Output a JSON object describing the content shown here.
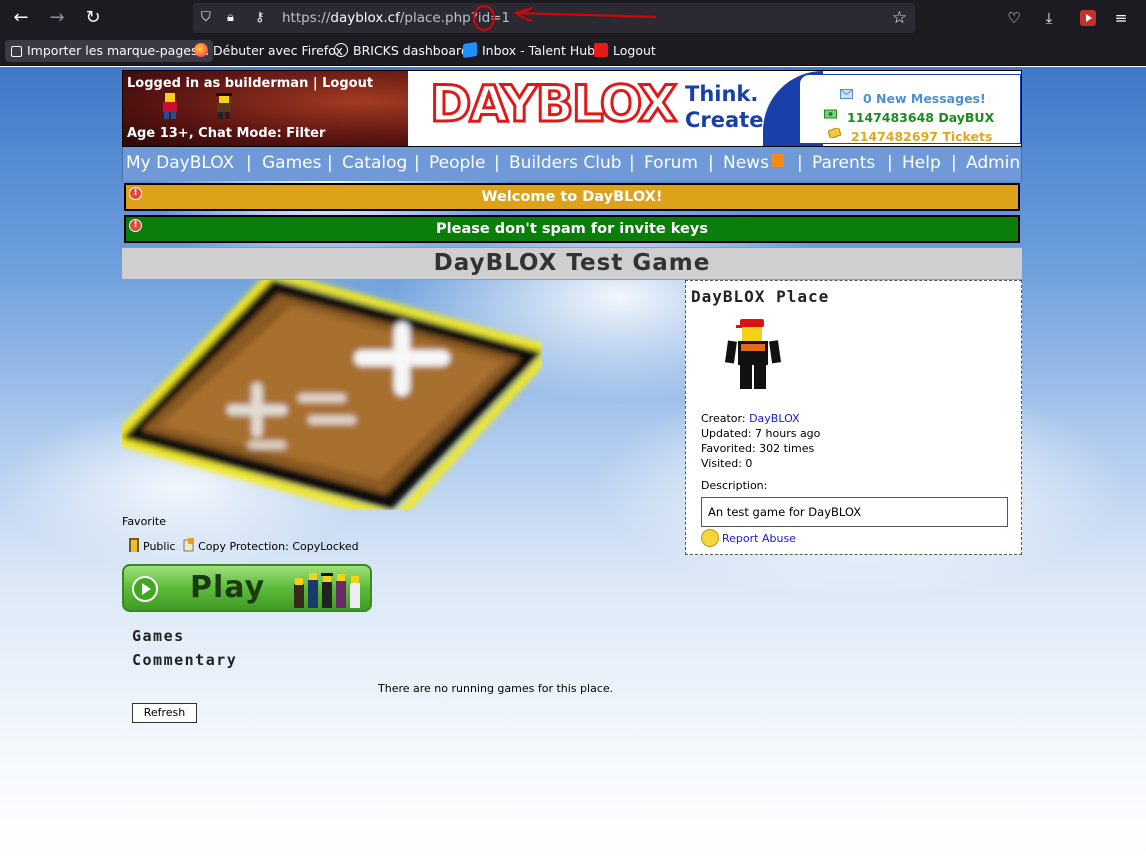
{
  "browser": {
    "url_prefix": "https://",
    "url_host": "dayblox.cf",
    "url_path": "/place.php?id=",
    "url_id": "1",
    "bookmarks": [
      {
        "label": "Importer les marque-pages..."
      },
      {
        "label": "Débuter avec Firefox"
      },
      {
        "label": "BRICKS dashboard"
      },
      {
        "label": "Inbox - Talent Hub"
      },
      {
        "label": "Logout"
      }
    ]
  },
  "header": {
    "login_text": "Logged in as builderman | Logout",
    "age_text": "Age 13+, Chat Mode: Filter",
    "logo": "DAYBLOX",
    "tagline_1": "Think.",
    "tagline_2": "Create.",
    "messages": "0 New Messages!",
    "daybux": "1147483648 DayBUX",
    "tickets": "2147482697 Tickets"
  },
  "nav": {
    "items": [
      "My DayBLOX",
      "Games",
      "Catalog",
      "People",
      "Builders Club",
      "Forum",
      "News",
      "Parents",
      "Help",
      "Admin"
    ],
    "separator": "|"
  },
  "alerts": {
    "welcome": "Welcome to DayBLOX!",
    "spam": "Please don't spam for invite keys",
    "warn_symbol": "!"
  },
  "place": {
    "title": "DayBLOX Test Game",
    "favorite_label": "Favorite",
    "access": "Public",
    "copy_protection": "Copy Protection: CopyLocked",
    "play_label": "Play",
    "tabs": [
      "Games",
      "Commentary"
    ],
    "no_games": "There are no running games for this place.",
    "refresh": "Refresh"
  },
  "sidebar": {
    "title": "DayBLOX Place",
    "creator_label": "Creator:",
    "creator_name": "DayBLOX",
    "updated": "Updated: 7 hours ago",
    "favorited": "Favorited: 302 times",
    "visited": "Visited: 0",
    "description_label": "Description:",
    "description": "An test game for DayBLOX",
    "report": "Report Abuse"
  },
  "colors": {
    "nav_bg": "#6f9ad7",
    "alert_yellow": "#dea21a",
    "alert_green": "#0b7d0b",
    "logo_red": "#e01818",
    "brand_blue": "#1a3fa8"
  }
}
